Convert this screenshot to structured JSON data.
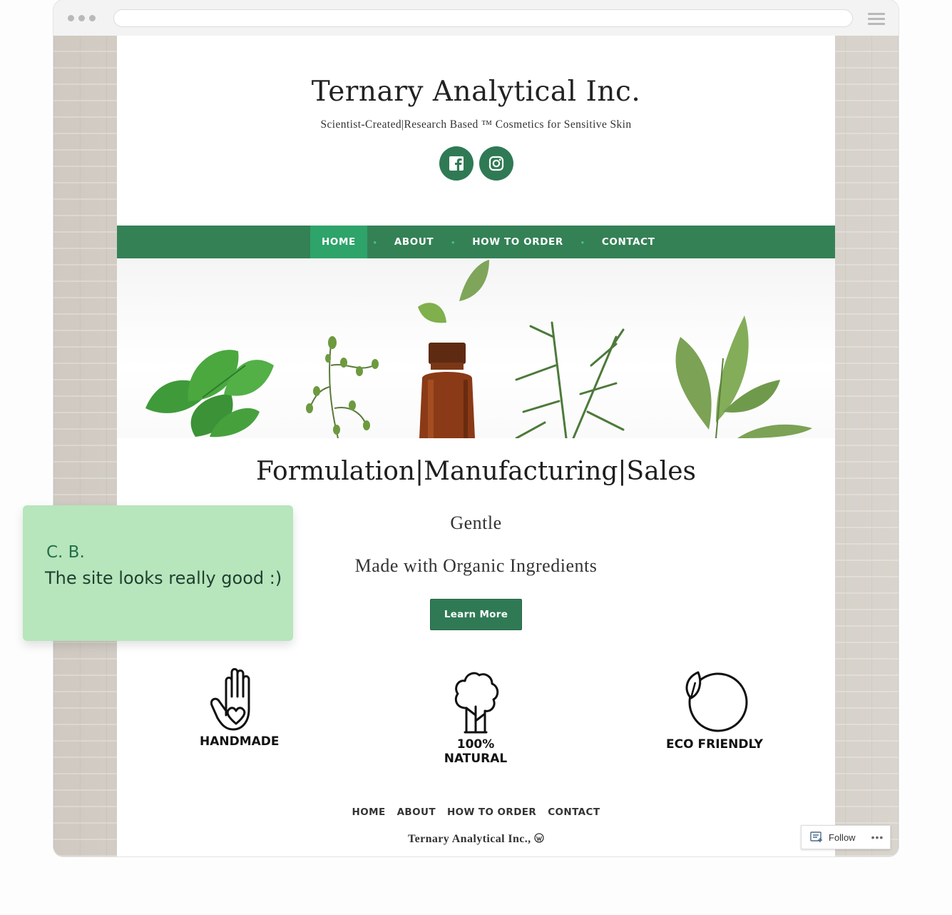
{
  "site": {
    "title": "Ternary Analytical Inc.",
    "tagline": "Scientist-Created|Research Based ™ Cosmetics for Sensitive Skin"
  },
  "social": [
    {
      "icon": "facebook-icon"
    },
    {
      "icon": "instagram-icon"
    }
  ],
  "nav": {
    "items": [
      {
        "label": "HOME",
        "active": true
      },
      {
        "label": "ABOUT",
        "active": false
      },
      {
        "label": "HOW TO ORDER",
        "active": false
      },
      {
        "label": "CONTACT",
        "active": false
      }
    ]
  },
  "main": {
    "headline": "Formulation|Manufacturing|Sales",
    "line1": "Gentle",
    "line2": "Made with Organic Ingredients",
    "cta_label": "Learn More"
  },
  "features": [
    {
      "label": "HANDMADE",
      "icon": "hand-heart-icon"
    },
    {
      "label": "100% NATURAL",
      "icon": "tree-icon"
    },
    {
      "label": "ECO FRIENDLY",
      "icon": "leaf-circle-icon"
    }
  ],
  "footer": {
    "nav": [
      "HOME",
      "ABOUT",
      "HOW TO ORDER",
      "CONTACT"
    ],
    "credit": "Ternary Analytical Inc.,"
  },
  "follow": {
    "label": "Follow",
    "more": "•••"
  },
  "comment": {
    "author": "C. B.",
    "text": "The site looks really good :)"
  },
  "colors": {
    "nav_bg": "#348156",
    "nav_active": "#2ea36a",
    "brand_green": "#2f7a55",
    "comment_bg": "#b7e5bc"
  }
}
